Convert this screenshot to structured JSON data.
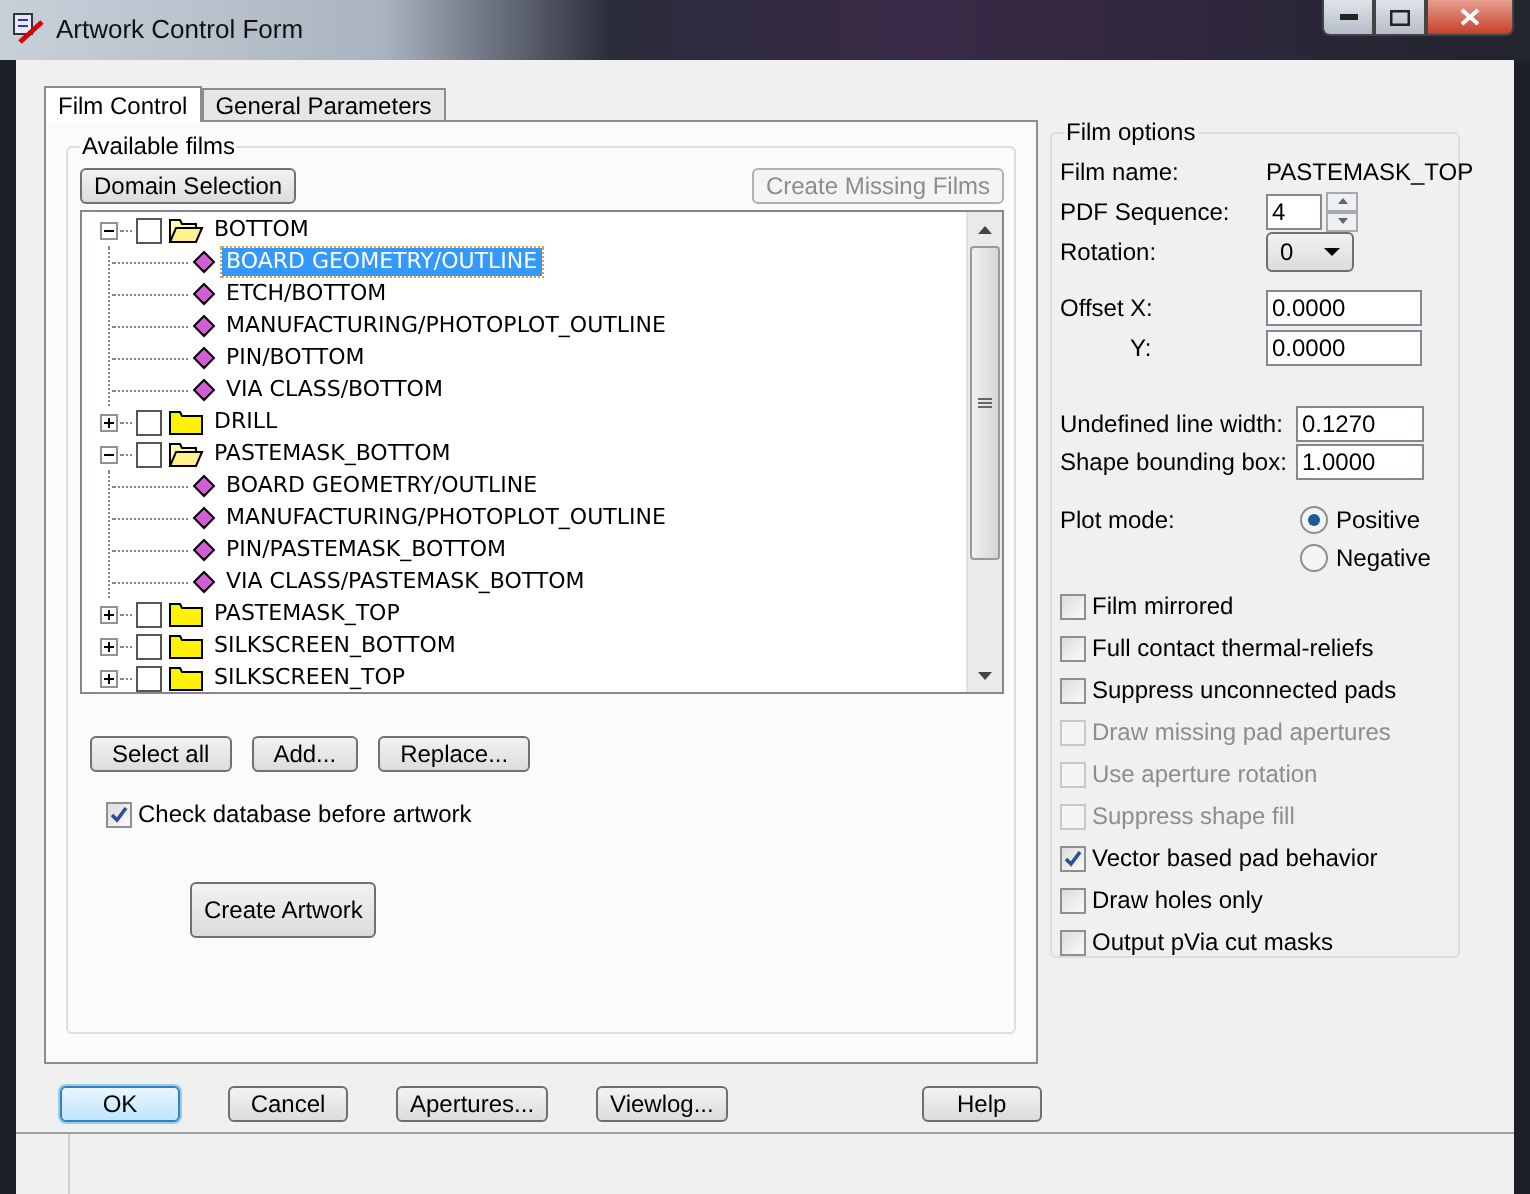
{
  "window": {
    "title": "Artwork Control Form"
  },
  "tabs": [
    {
      "label": "Film Control",
      "selected": true
    },
    {
      "label": "General Parameters",
      "selected": false
    }
  ],
  "film_control": {
    "group_title": "Available films",
    "domain_button": {
      "label": "Domain Selection",
      "disabled": false
    },
    "create_missing_button": {
      "label": "Create Missing Films",
      "disabled": true
    },
    "tree": [
      {
        "kind": "folder",
        "label": "BOTTOM",
        "checked": false,
        "expanded": true,
        "selected": false,
        "children": [
          {
            "kind": "layer",
            "label": "BOARD GEOMETRY/OUTLINE",
            "selected": true
          },
          {
            "kind": "layer",
            "label": "ETCH/BOTTOM",
            "selected": false
          },
          {
            "kind": "layer",
            "label": "MANUFACTURING/PHOTOPLOT_OUTLINE",
            "selected": false
          },
          {
            "kind": "layer",
            "label": "PIN/BOTTOM",
            "selected": false
          },
          {
            "kind": "layer",
            "label": "VIA CLASS/BOTTOM",
            "selected": false
          }
        ]
      },
      {
        "kind": "folder",
        "label": "DRILL",
        "checked": false,
        "expanded": false,
        "selected": false
      },
      {
        "kind": "folder",
        "label": "PASTEMASK_BOTTOM",
        "checked": false,
        "expanded": true,
        "selected": false,
        "children": [
          {
            "kind": "layer",
            "label": "BOARD GEOMETRY/OUTLINE",
            "selected": false
          },
          {
            "kind": "layer",
            "label": "MANUFACTURING/PHOTOPLOT_OUTLINE",
            "selected": false
          },
          {
            "kind": "layer",
            "label": "PIN/PASTEMASK_BOTTOM",
            "selected": false
          },
          {
            "kind": "layer",
            "label": "VIA CLASS/PASTEMASK_BOTTOM",
            "selected": false
          }
        ]
      },
      {
        "kind": "folder",
        "label": "PASTEMASK_TOP",
        "checked": false,
        "expanded": false,
        "selected": false
      },
      {
        "kind": "folder",
        "label": "SILKSCREEN_BOTTOM",
        "checked": false,
        "expanded": false,
        "selected": false
      },
      {
        "kind": "folder",
        "label": "SILKSCREEN_TOP",
        "checked": false,
        "expanded": false,
        "selected": false
      }
    ],
    "buttons": [
      "Select all",
      "Add...",
      "Replace..."
    ],
    "check_database": {
      "label": "Check database before artwork",
      "checked": true
    },
    "create_artwork": "Create Artwork"
  },
  "film_options": {
    "group_title": "Film options",
    "film_name": {
      "label": "Film name:",
      "value": "PASTEMASK_TOP"
    },
    "pdf_sequence": {
      "label": "PDF Sequence:",
      "value": "4"
    },
    "rotation": {
      "label": "Rotation:",
      "value": "0"
    },
    "offset": {
      "label": "Offset",
      "x_label": "X:",
      "x_value": "0.0000",
      "y_label": "Y:",
      "y_value": "0.0000"
    },
    "undefined_line_width": {
      "label": "Undefined line width:",
      "value": "0.1270"
    },
    "shape_bounding_box": {
      "label": "Shape bounding box:",
      "value": "1.0000"
    },
    "plot_mode": {
      "label": "Plot mode:",
      "options": [
        {
          "label": "Positive",
          "selected": true
        },
        {
          "label": "Negative",
          "selected": false
        }
      ]
    },
    "checkboxes": [
      {
        "label": "Film mirrored",
        "checked": false,
        "disabled": false
      },
      {
        "label": "Full contact thermal-reliefs",
        "checked": false,
        "disabled": false
      },
      {
        "label": "Suppress unconnected pads",
        "checked": false,
        "disabled": false
      },
      {
        "label": "Draw missing pad apertures",
        "checked": false,
        "disabled": true
      },
      {
        "label": "Use aperture rotation",
        "checked": false,
        "disabled": true
      },
      {
        "label": "Suppress shape fill",
        "checked": false,
        "disabled": true
      },
      {
        "label": "Vector based pad behavior",
        "checked": true,
        "disabled": false
      },
      {
        "label": "Draw holes only",
        "checked": false,
        "disabled": false
      },
      {
        "label": "Output pVia cut masks",
        "checked": false,
        "disabled": false
      }
    ]
  },
  "footer_buttons": [
    {
      "label": "OK",
      "default": true
    },
    {
      "label": "Cancel",
      "default": false
    },
    {
      "label": "Apertures...",
      "default": false
    },
    {
      "label": "Viewlog...",
      "default": false
    },
    {
      "label": "Help",
      "default": false
    }
  ]
}
